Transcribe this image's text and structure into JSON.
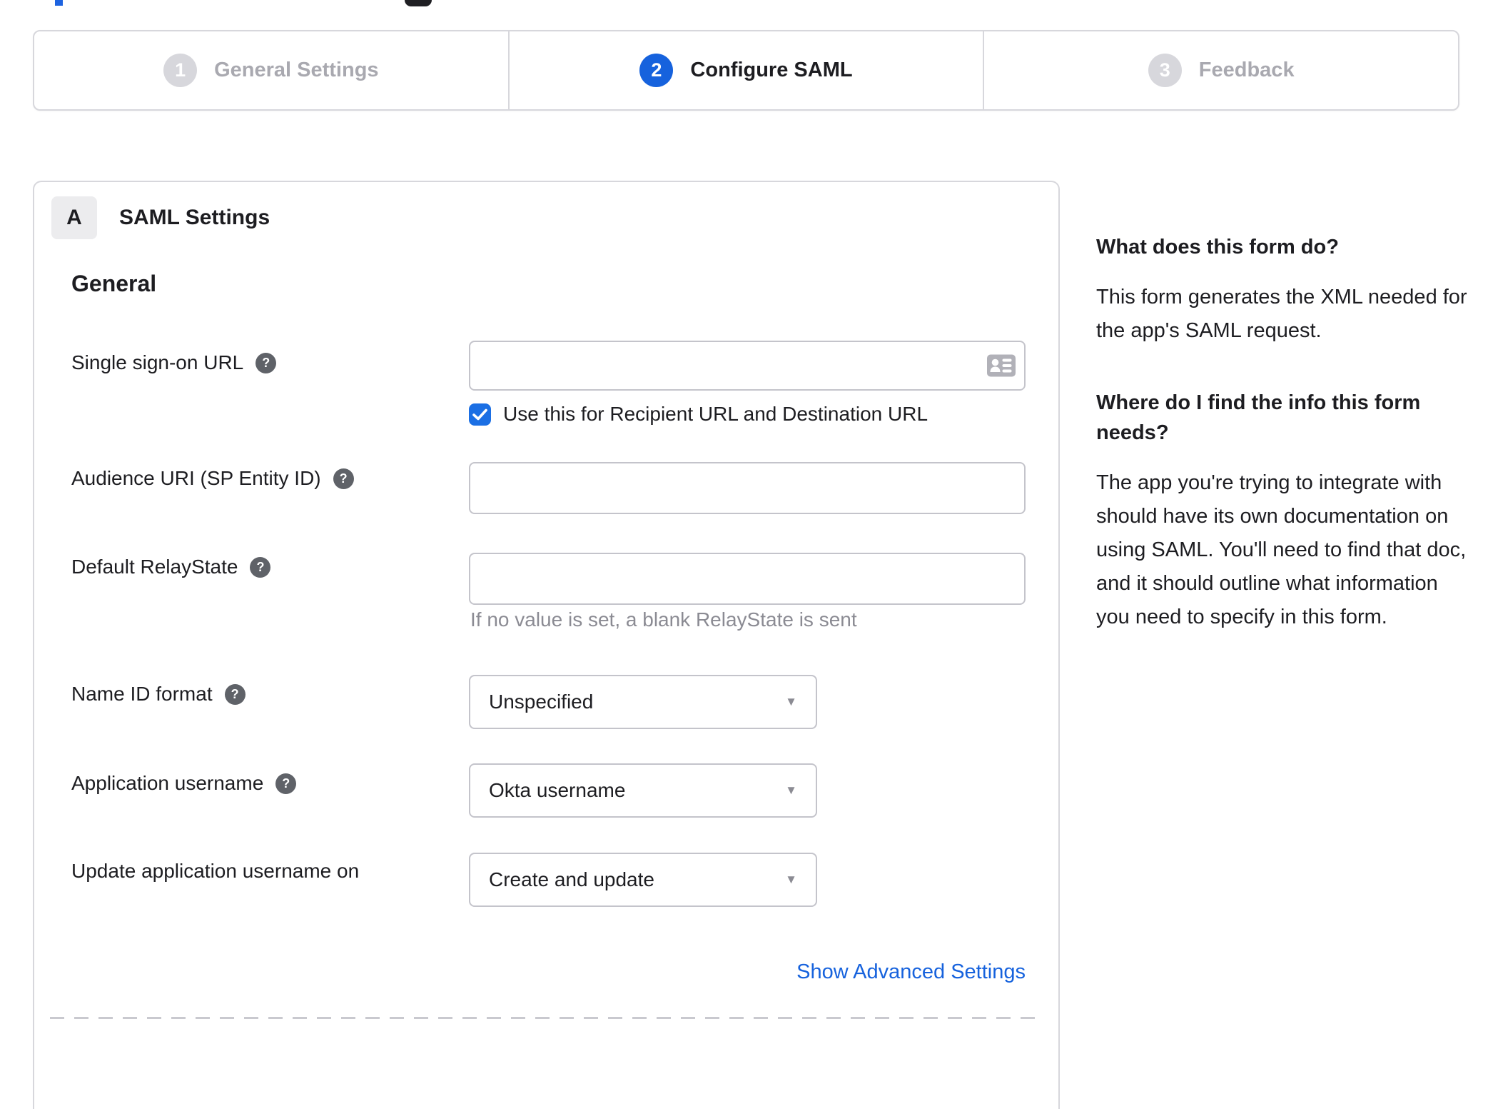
{
  "stepper": {
    "steps": [
      {
        "number": "1",
        "label": "General Settings",
        "state": "inactive"
      },
      {
        "number": "2",
        "label": "Configure SAML",
        "state": "active"
      },
      {
        "number": "3",
        "label": "Feedback",
        "state": "inactive"
      }
    ]
  },
  "panel": {
    "badge": "A",
    "title": "SAML Settings",
    "section_heading": "General",
    "fields": {
      "sso": {
        "label": "Single sign-on URL",
        "value": "",
        "has_help": true
      },
      "sso_checkbox": {
        "label": "Use this for Recipient URL and Destination URL",
        "checked": true
      },
      "audience": {
        "label": "Audience URI (SP Entity ID)",
        "value": "",
        "has_help": true
      },
      "relay": {
        "label": "Default RelayState",
        "value": "",
        "has_help": true,
        "hint": "If no value is set, a blank RelayState is sent"
      },
      "name_id": {
        "label": "Name ID format",
        "value": "Unspecified",
        "has_help": true
      },
      "app_username": {
        "label": "Application username",
        "value": "Okta username",
        "has_help": true
      },
      "update_username": {
        "label": "Update application username on",
        "value": "Create and update",
        "has_help": false
      }
    },
    "advanced_link": "Show Advanced Settings"
  },
  "sidebar": {
    "q1": "What does this form do?",
    "a1": "This form generates the XML needed for the app's SAML request.",
    "q2": "Where do I find the info this form needs?",
    "a2": "The app you're trying to integrate with should have its own documentation on using SAML. You'll need to find that doc, and it should outline what information you need to specify in this form."
  },
  "icons": {
    "help_glyph": "?",
    "dropdown_arrow": "▼"
  },
  "colors": {
    "accent_blue": "#1662dd",
    "checkbox_blue": "#1b6fe4",
    "inactive_gray": "#d7d7dc",
    "border_gray": "#c4c4cb",
    "muted_text": "#8b8b93"
  }
}
